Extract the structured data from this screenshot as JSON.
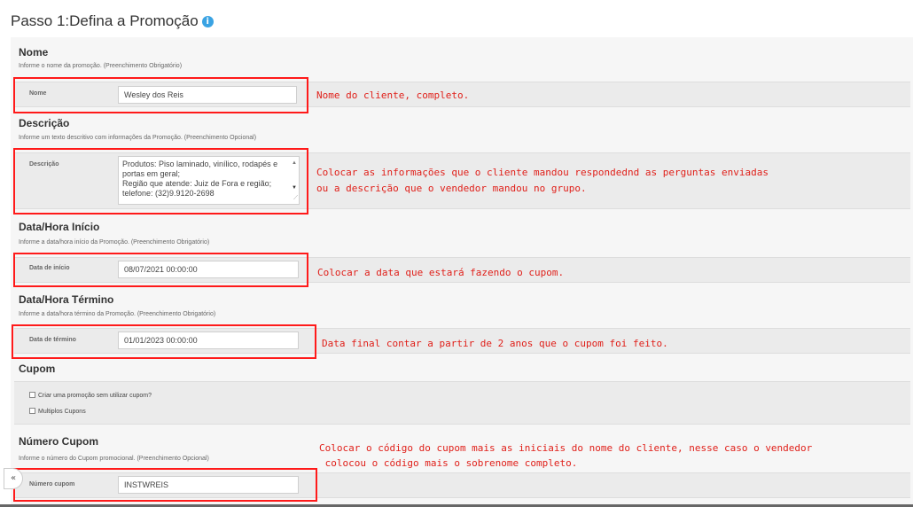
{
  "page": {
    "title": "Passo 1:Defina a Promoção",
    "info_glyph": "i"
  },
  "sections": {
    "nome": {
      "title": "Nome",
      "desc": "Informe o nome da promoção. (Preenchimento Obrigatório)",
      "label": "Nome",
      "value": "Wesley dos Reis",
      "note": "Nome do cliente, completo."
    },
    "descricao": {
      "title": "Descrição",
      "desc": "Informe um texto descritivo com informações da Promoção. (Preenchimento Opcional)",
      "label": "Descrição",
      "lines": [
        "Produtos: Piso laminado, vinílico, rodapés e",
        "portas em geral;",
        "Região que atende: Juiz de Fora e região;",
        "telefone: (32)9.9120-2698"
      ],
      "note_lines": [
        "Colocar as informações que o cliente mandou respondednd as perguntas enviadas",
        "ou a descrição que o vendedor mandou no grupo."
      ]
    },
    "inicio": {
      "title": "Data/Hora Início",
      "desc": "Informe a data/hora início da Promoção. (Preenchimento Obrigatório)",
      "label": "Data de início",
      "value": "08/07/2021 00:00:00",
      "note": "Colocar a data que estará fazendo o cupom."
    },
    "termino": {
      "title": "Data/Hora Término",
      "desc": "Informe a data/hora término da Promoção. (Preenchimento Obrigatório)",
      "label": "Data de término",
      "value": "01/01/2023 00:00:00",
      "note": "Data final contar a partir de 2 anos que o cupom foi feito."
    },
    "cupom": {
      "title": "Cupom",
      "checkbox1": "Criar uma promoção sem utilizar cupom?",
      "checkbox2": "Multiplos Cupons"
    },
    "numero_cupom": {
      "title": "Número Cupom",
      "desc": "Informe o número do Cupom promocional. (Preenchimento Opcional)",
      "label": "Número cupom",
      "value": "INSTWREIS",
      "note_lines": [
        "Colocar o código do cupom mais as iniciais do nome do cliente, nesse caso o vendedor",
        " colocou o código mais o sobrenome completo."
      ]
    }
  },
  "ui": {
    "collapse_glyph": "«"
  },
  "colors": {
    "annotation": "#ff1a1a",
    "info": "#3aa3e3"
  }
}
